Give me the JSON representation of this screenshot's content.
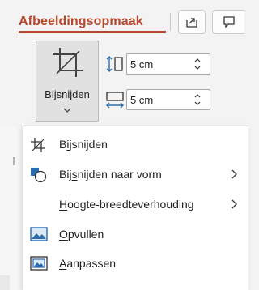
{
  "ribbon": {
    "tab_title": "Afbeeldingsopmaak",
    "share_icon": "share-icon",
    "comment_icon": "comment-icon",
    "crop_button": {
      "label": "Bijsnijden",
      "icon": "crop-icon"
    },
    "height": {
      "value": "5 cm",
      "icon": "shape-height-icon"
    },
    "width": {
      "value": "5 cm",
      "icon": "shape-width-icon"
    }
  },
  "menu": {
    "items": [
      {
        "label_pre": "B",
        "label_u": "i",
        "label_post": "jsnijden",
        "icon": "crop-icon",
        "has_submenu": false
      },
      {
        "label_pre": "Bij",
        "label_u": "s",
        "label_post": "nijden naar vorm",
        "icon": "crop-to-shape-icon",
        "has_submenu": true
      },
      {
        "label_pre": "",
        "label_u": "H",
        "label_post": "oogte-breedteverhouding",
        "icon": "",
        "has_submenu": true
      },
      {
        "label_pre": "",
        "label_u": "O",
        "label_post": "pvullen",
        "icon": "fill-icon",
        "has_submenu": false
      },
      {
        "label_pre": "",
        "label_u": "A",
        "label_post": "anpassen",
        "icon": "fit-icon",
        "has_submenu": false
      }
    ]
  },
  "colors": {
    "accent": "#b7472a",
    "icon_blue": "#2b6cb0"
  }
}
